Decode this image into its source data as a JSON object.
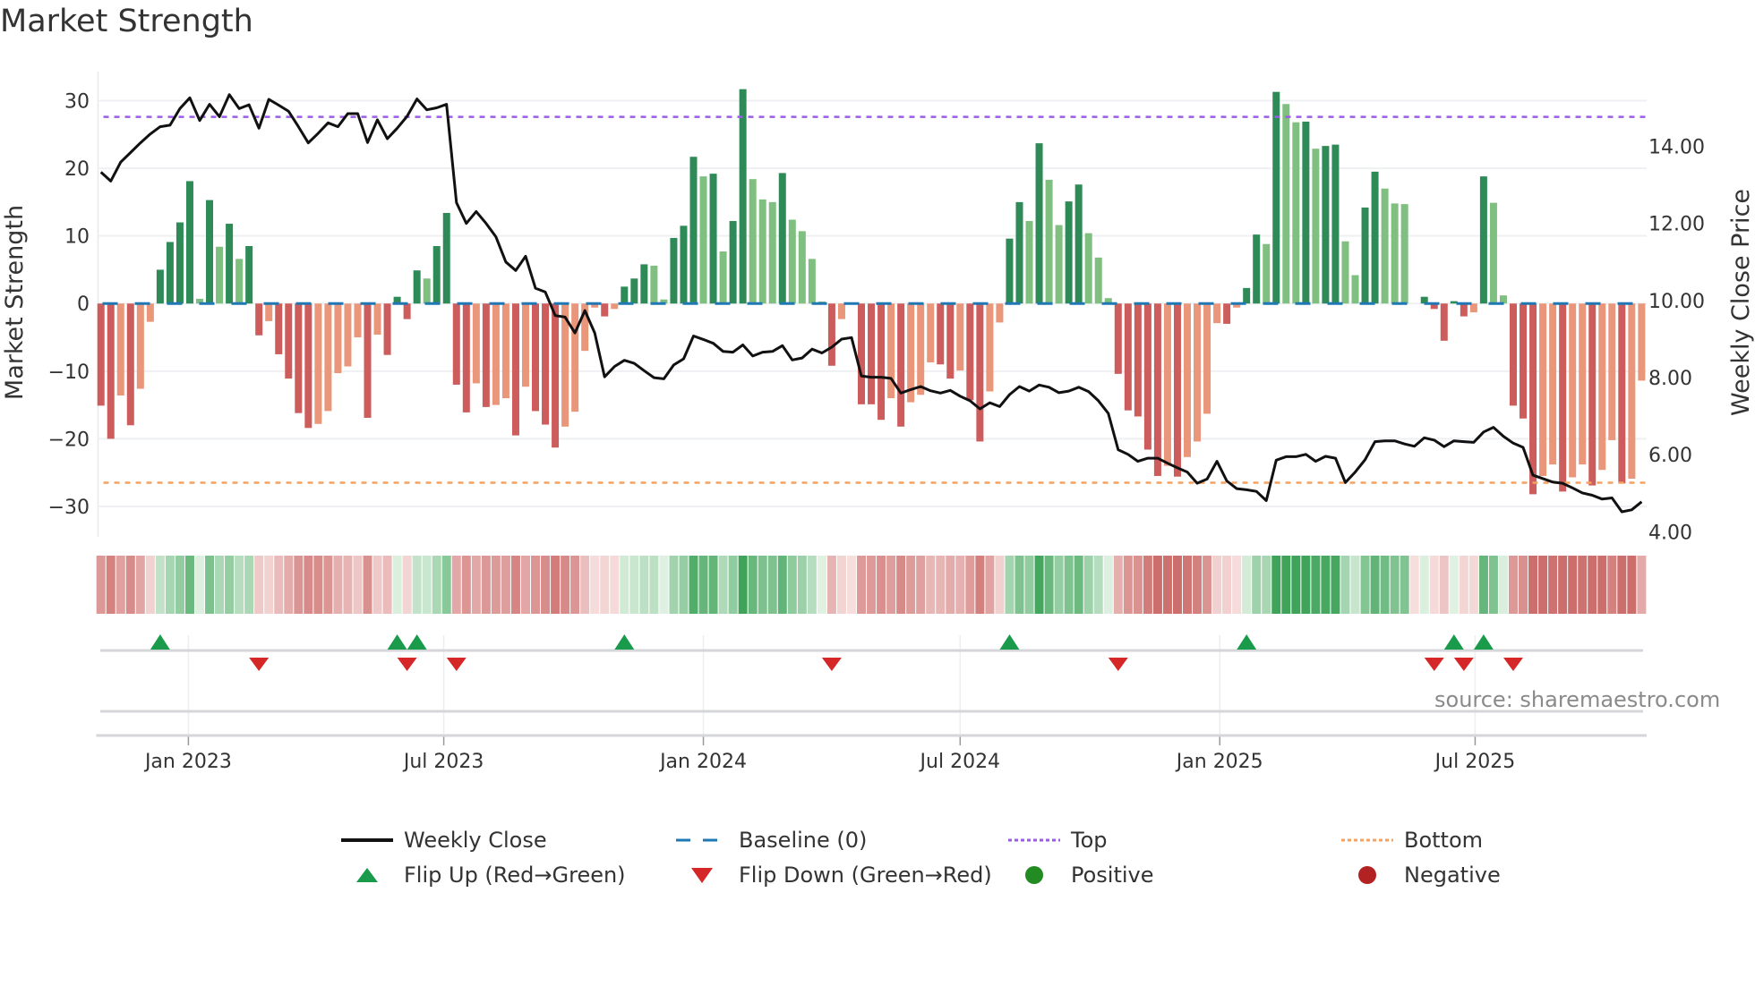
{
  "title": "Market Strength",
  "source": "source: sharemaestro.com",
  "colors": {
    "pos_strong": "#2e8b57",
    "pos_weak": "#7fbf7f",
    "neg_strong": "#cd5c5c",
    "neg_weak": "#e9967a",
    "close": "#111111",
    "baseline": "#1f77b4",
    "top": "#9b5de5",
    "bottom": "#f4a261",
    "flip_up": "#1a9b4b",
    "flip_down": "#d62728",
    "positive": "#228b22",
    "negative": "#b22222"
  },
  "legend": [
    {
      "key": "close",
      "label": "Weekly Close",
      "symbol": "line"
    },
    {
      "key": "baseline",
      "label": "Baseline (0)",
      "symbol": "dash"
    },
    {
      "key": "top",
      "label": "Top",
      "symbol": "dot"
    },
    {
      "key": "bottom",
      "label": "Bottom",
      "symbol": "dot"
    },
    {
      "key": "flip_up",
      "label": "Flip Up (Red→Green)",
      "symbol": "tri-up"
    },
    {
      "key": "flip_down",
      "label": "Flip Down (Green→Red)",
      "symbol": "tri-down"
    },
    {
      "key": "positive",
      "label": "Positive",
      "symbol": "circle"
    },
    {
      "key": "negative",
      "label": "Negative",
      "symbol": "circle"
    }
  ],
  "chart_data": {
    "type": "bar",
    "title": "Market Strength",
    "ylabel": "Market Strength",
    "y2label": "Weekly Close Price",
    "start_date": "2022-10-31",
    "frequency": "weekly",
    "ylim": [
      -34.5,
      34.3
    ],
    "y2lim": [
      3.87,
      15.94
    ],
    "yticks": [
      30,
      20,
      10,
      0,
      -10,
      -20,
      -30
    ],
    "yticklabels": [
      "30",
      "20",
      "10",
      "0",
      "−10",
      "−20",
      "−30"
    ],
    "y2ticks": [
      14,
      12,
      10,
      8,
      6,
      4
    ],
    "y2ticklabels": [
      "14.00",
      "12.00",
      "10.00",
      "8.00",
      "6.00",
      "4.00"
    ],
    "xticks": [
      {
        "date": "2023-01-01",
        "label": "Jan 2023"
      },
      {
        "date": "2023-07-01",
        "label": "Jul 2023"
      },
      {
        "date": "2024-01-01",
        "label": "Jan 2024"
      },
      {
        "date": "2024-07-01",
        "label": "Jul 2024"
      },
      {
        "date": "2025-01-01",
        "label": "Jan 2025"
      },
      {
        "date": "2025-07-01",
        "label": "Jul 2025"
      }
    ],
    "top_level": 27.6,
    "bottom_level": -26.5,
    "baseline": 0,
    "strength": [
      -15.1,
      -20.0,
      -13.6,
      -18.0,
      -12.6,
      -2.7,
      5.0,
      9.1,
      12.0,
      18.1,
      0.7,
      15.3,
      8.4,
      11.8,
      6.6,
      8.5,
      -4.7,
      -2.6,
      -7.5,
      -11.1,
      -16.2,
      -18.4,
      -17.8,
      -15.9,
      -10.3,
      -9.3,
      -5.0,
      -16.9,
      -4.6,
      -7.6,
      1.0,
      -2.3,
      4.9,
      3.7,
      8.5,
      13.4,
      -12.0,
      -16.1,
      -11.8,
      -15.3,
      -15.0,
      -14.0,
      -19.5,
      -12.3,
      -15.9,
      -17.9,
      -21.3,
      -18.2,
      -16.0,
      -7.0,
      -0.6,
      -1.9,
      -0.8,
      2.5,
      3.7,
      5.8,
      5.6,
      0.6,
      9.7,
      11.5,
      21.7,
      18.8,
      19.2,
      7.7,
      12.2,
      31.7,
      18.4,
      15.4,
      15.0,
      19.3,
      12.4,
      10.7,
      6.6,
      0.3,
      -9.2,
      -2.3,
      0,
      -14.9,
      -14.9,
      -17.2,
      -14.0,
      -18.2,
      -14.6,
      -13.5,
      -8.7,
      -9.0,
      -11.1,
      -9.9,
      -14.3,
      -20.4,
      -13.0,
      -2.8,
      9.6,
      15.0,
      12.2,
      23.7,
      18.3,
      11.6,
      15.1,
      17.6,
      10.4,
      6.8,
      0.8,
      -10.4,
      -15.8,
      -16.7,
      -21.6,
      -25.5,
      -24.0,
      -25.6,
      -22.7,
      -20.4,
      -16.3,
      -2.9,
      -3.0,
      -0.6,
      2.3,
      10.2,
      8.8,
      31.3,
      29.5,
      26.8,
      26.9,
      22.9,
      23.3,
      23.5,
      9.2,
      4.2,
      14.2,
      19.5,
      17.0,
      14.8,
      14.7,
      0,
      1.0,
      -0.8,
      -5.5,
      0.35,
      -1.9,
      -1.3,
      18.8,
      14.9,
      1.2,
      -15.1,
      -17.0,
      -28.2,
      -25.5,
      -23.8,
      -27.8,
      -25.7,
      -23.8,
      -26.9,
      -24.6,
      -20.2,
      -26.6,
      -25.9,
      -11.4
    ],
    "weekly_close": [
      13.33,
      13.1,
      13.59,
      13.84,
      14.09,
      14.32,
      14.51,
      14.55,
      14.98,
      15.26,
      14.67,
      15.09,
      14.77,
      15.34,
      14.98,
      15.08,
      14.47,
      15.22,
      15.07,
      14.91,
      14.51,
      14.09,
      14.34,
      14.61,
      14.51,
      14.85,
      14.85,
      14.1,
      14.69,
      14.2,
      14.47,
      14.78,
      15.23,
      14.95,
      15.0,
      15.09,
      12.54,
      12.0,
      12.31,
      12.0,
      11.65,
      11.0,
      10.78,
      11.15,
      10.32,
      10.22,
      9.61,
      9.57,
      9.16,
      9.74,
      9.16,
      8.02,
      8.29,
      8.45,
      8.37,
      8.18,
      8.0,
      7.97,
      8.33,
      8.49,
      9.08,
      8.99,
      8.89,
      8.68,
      8.66,
      8.85,
      8.56,
      8.66,
      8.68,
      8.83,
      8.46,
      8.51,
      8.74,
      8.64,
      8.79,
      9.0,
      9.04,
      8.04,
      8.01,
      8.01,
      7.98,
      7.6,
      7.69,
      7.77,
      7.66,
      7.6,
      7.67,
      7.52,
      7.4,
      7.19,
      7.35,
      7.25,
      7.56,
      7.77,
      7.65,
      7.81,
      7.75,
      7.61,
      7.65,
      7.75,
      7.64,
      7.4,
      7.07,
      6.13,
      6.01,
      5.83,
      5.91,
      5.91,
      5.78,
      5.66,
      5.55,
      5.26,
      5.37,
      5.83,
      5.32,
      5.12,
      5.09,
      5.05,
      4.81,
      5.86,
      5.95,
      5.95,
      6.01,
      5.83,
      5.96,
      5.91,
      5.28,
      5.55,
      5.87,
      6.34,
      6.36,
      6.36,
      6.28,
      6.22,
      6.44,
      6.38,
      6.21,
      6.36,
      6.34,
      6.32,
      6.59,
      6.71,
      6.48,
      6.3,
      6.19,
      5.47,
      5.38,
      5.29,
      5.26,
      5.14,
      5.01,
      4.95,
      4.85,
      4.88,
      4.52,
      4.57,
      4.78
    ],
    "flip_up_weeks": [
      7,
      31,
      33,
      54,
      93,
      117,
      138,
      141
    ],
    "flip_down_weeks": [
      17,
      32,
      37,
      75,
      104,
      136,
      139,
      144
    ],
    "legend_position": "bottom"
  }
}
